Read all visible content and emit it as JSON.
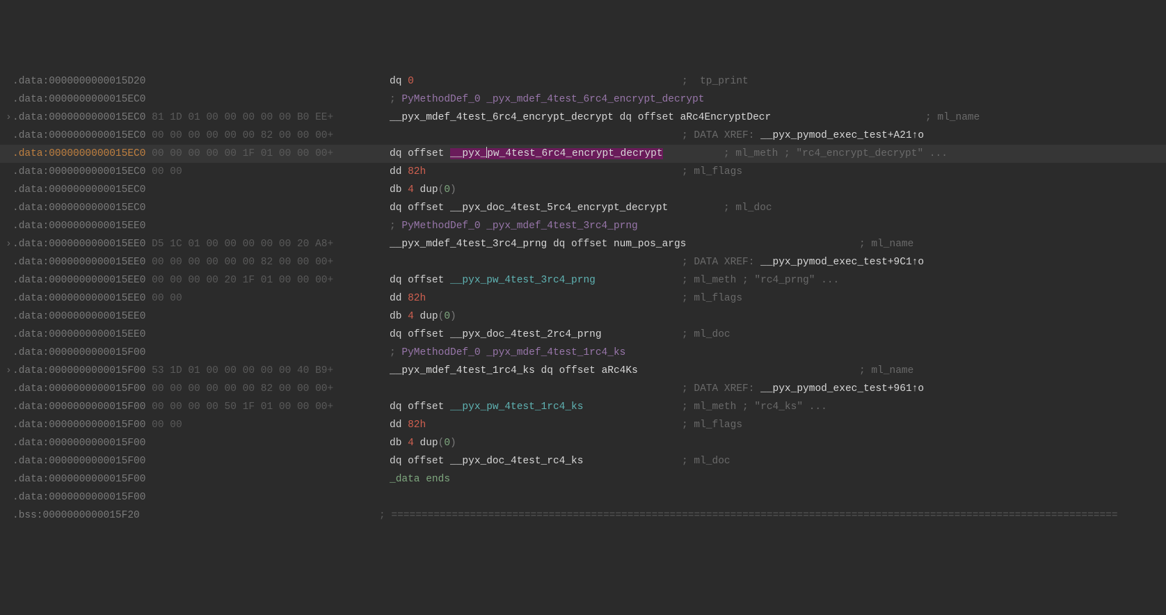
{
  "colors": {
    "bg": "#2b2b2b",
    "highlightBg": "#363636",
    "selBg": "#6a1b5a"
  },
  "lines": [
    {
      "addr": ".data:0000000000015D20",
      "hex": "",
      "parts": [
        {
          "t": "dq ",
          "c": "instr-white"
        },
        {
          "t": "0",
          "c": "num-red"
        }
      ],
      "tail": ";  tp_print",
      "tailCol": 980
    },
    {
      "addr": ".data:0000000000015EC0",
      "hex": "",
      "parts": [
        {
          "t": "; ",
          "c": "comment-gray"
        },
        {
          "t": "PyMethodDef_0 _pyx_mdef_4test_6rc4_encrypt_decrypt",
          "c": "comment-purple"
        }
      ]
    },
    {
      "arrow": "›",
      "addr": ".data:0000000000015EC0",
      "hex": " 81 1D 01 00 00 00 00 00 B0 EE+",
      "parts": [
        {
          "t": "__pyx_mdef_4test_6rc4_encrypt_decrypt",
          "c": "symbol-white"
        },
        {
          "t": " dq offset ",
          "c": "instr-white"
        },
        {
          "t": "aRc4EncryptDecr",
          "c": "symbol-white"
        }
      ],
      "tail": "; ml_name",
      "tailCol": 1330
    },
    {
      "addr": ".data:0000000000015EC0",
      "hex": " 00 00 00 00 00 00 82 00 00 00+",
      "parts": [],
      "tail": "; DATA XREF: __pyx_pymod_exec_test+A21↑o",
      "tailCol": 980,
      "tailWhite": true
    },
    {
      "hl": true,
      "addr": ".data:0000000000015EC0",
      "addrClass": "seg-orange",
      "hex": " 00 00 00 00 00 1F 01 00 00 00+",
      "parts": [
        {
          "t": "dq offset ",
          "c": "instr-white"
        },
        {
          "t": "__pyx_",
          "c": "highlight-sym"
        },
        {
          "cursor": true
        },
        {
          "t": "pw_4test_6rc4_encrypt_decrypt",
          "c": "highlight-sym"
        }
      ],
      "tail": "; ml_meth ; \"rc4_encrypt_decrypt\" ...",
      "tailCol": 1040
    },
    {
      "addr": ".data:0000000000015EC0",
      "hex": " 00 00",
      "parts": [
        {
          "t": "dd ",
          "c": "instr-white"
        },
        {
          "t": "82h",
          "c": "num-red"
        }
      ],
      "tail": "; ml_flags",
      "tailCol": 980
    },
    {
      "addr": ".data:0000000000015EC0",
      "hex": "",
      "parts": [
        {
          "t": "db ",
          "c": "instr-white"
        },
        {
          "t": "4",
          "c": "num-red"
        },
        {
          "t": " dup",
          "c": "instr-white"
        },
        {
          "t": "(",
          "c": "paren-gray"
        },
        {
          "t": "0",
          "c": "num-green"
        },
        {
          "t": ")",
          "c": "paren-gray"
        }
      ]
    },
    {
      "addr": ".data:0000000000015EC0",
      "hex": "",
      "parts": [
        {
          "t": "dq offset ",
          "c": "instr-white"
        },
        {
          "t": "__pyx_doc_4test_5rc4_encrypt_decrypt",
          "c": "symbol-white"
        }
      ],
      "tail": "; ml_doc",
      "tailCol": 1040
    },
    {
      "addr": ".data:0000000000015EE0",
      "hex": "",
      "parts": [
        {
          "t": "; ",
          "c": "comment-gray"
        },
        {
          "t": "PyMethodDef_0 _pyx_mdef_4test_3rc4_prng",
          "c": "comment-purple"
        }
      ]
    },
    {
      "arrow": "›",
      "addr": ".data:0000000000015EE0",
      "hex": " D5 1C 01 00 00 00 00 00 20 A8+",
      "parts": [
        {
          "t": "__pyx_mdef_4test_3rc4_prng",
          "c": "symbol-white"
        },
        {
          "t": " dq offset ",
          "c": "instr-white"
        },
        {
          "t": "num_pos_args",
          "c": "symbol-white"
        }
      ],
      "tail": "; ml_name",
      "tailCol": 1235
    },
    {
      "addr": ".data:0000000000015EE0",
      "hex": " 00 00 00 00 00 00 82 00 00 00+",
      "parts": [],
      "tail": "; DATA XREF: __pyx_pymod_exec_test+9C1↑o",
      "tailCol": 980,
      "tailWhite": true
    },
    {
      "addr": ".data:0000000000015EE0",
      "hex": " 00 00 00 00 20 1F 01 00 00 00+",
      "parts": [
        {
          "t": "dq offset ",
          "c": "instr-white"
        },
        {
          "t": "__pyx_pw_4test_3rc4_prng",
          "c": "symbol-teal"
        }
      ],
      "tail": "; ml_meth ; \"rc4_prng\" ...",
      "tailCol": 980
    },
    {
      "addr": ".data:0000000000015EE0",
      "hex": " 00 00",
      "parts": [
        {
          "t": "dd ",
          "c": "instr-white"
        },
        {
          "t": "82h",
          "c": "num-red"
        }
      ],
      "tail": "; ml_flags",
      "tailCol": 980
    },
    {
      "addr": ".data:0000000000015EE0",
      "hex": "",
      "parts": [
        {
          "t": "db ",
          "c": "instr-white"
        },
        {
          "t": "4",
          "c": "num-red"
        },
        {
          "t": " dup",
          "c": "instr-white"
        },
        {
          "t": "(",
          "c": "paren-gray"
        },
        {
          "t": "0",
          "c": "num-green"
        },
        {
          "t": ")",
          "c": "paren-gray"
        }
      ]
    },
    {
      "addr": ".data:0000000000015EE0",
      "hex": "",
      "parts": [
        {
          "t": "dq offset ",
          "c": "instr-white"
        },
        {
          "t": "__pyx_doc_4test_2rc4_prng",
          "c": "symbol-white"
        }
      ],
      "tail": "; ml_doc",
      "tailCol": 980
    },
    {
      "addr": ".data:0000000000015F00",
      "hex": "",
      "parts": [
        {
          "t": "; ",
          "c": "comment-gray"
        },
        {
          "t": "PyMethodDef_0 _pyx_mdef_4test_1rc4_ks",
          "c": "comment-purple"
        }
      ]
    },
    {
      "arrow": "›",
      "addr": ".data:0000000000015F00",
      "hex": " 53 1D 01 00 00 00 00 00 40 B9+",
      "parts": [
        {
          "t": "__pyx_mdef_4test_1rc4_ks",
          "c": "symbol-white"
        },
        {
          "t": " dq offset ",
          "c": "instr-white"
        },
        {
          "t": "aRc4Ks",
          "c": "symbol-white"
        }
      ],
      "tail": "; ml_name",
      "tailCol": 1235
    },
    {
      "addr": ".data:0000000000015F00",
      "hex": " 00 00 00 00 00 00 82 00 00 00+",
      "parts": [],
      "tail": "; DATA XREF: __pyx_pymod_exec_test+961↑o",
      "tailCol": 980,
      "tailWhite": true
    },
    {
      "addr": ".data:0000000000015F00",
      "hex": " 00 00 00 00 50 1F 01 00 00 00+",
      "parts": [
        {
          "t": "dq offset ",
          "c": "instr-white"
        },
        {
          "t": "__pyx_pw_4test_1rc4_ks",
          "c": "symbol-teal"
        }
      ],
      "tail": "; ml_meth ; \"rc4_ks\" ...",
      "tailCol": 980
    },
    {
      "addr": ".data:0000000000015F00",
      "hex": " 00 00",
      "parts": [
        {
          "t": "dd ",
          "c": "instr-white"
        },
        {
          "t": "82h",
          "c": "num-red"
        }
      ],
      "tail": "; ml_flags",
      "tailCol": 980
    },
    {
      "addr": ".data:0000000000015F00",
      "hex": "",
      "parts": [
        {
          "t": "db ",
          "c": "instr-white"
        },
        {
          "t": "4",
          "c": "num-red"
        },
        {
          "t": " dup",
          "c": "instr-white"
        },
        {
          "t": "(",
          "c": "paren-gray"
        },
        {
          "t": "0",
          "c": "num-green"
        },
        {
          "t": ")",
          "c": "paren-gray"
        }
      ]
    },
    {
      "addr": ".data:0000000000015F00",
      "hex": "",
      "parts": [
        {
          "t": "dq offset ",
          "c": "instr-white"
        },
        {
          "t": "__pyx_doc_4test_rc4_ks",
          "c": "symbol-white"
        }
      ],
      "tail": "; ml_doc",
      "tailCol": 980
    },
    {
      "addr": ".data:0000000000015F00",
      "hex": "",
      "parts": [
        {
          "t": "_data ",
          "c": "dataends"
        },
        {
          "t": "ends",
          "c": "dataends"
        }
      ]
    },
    {
      "addr": ".data:0000000000015F00",
      "hex": "",
      "parts": []
    },
    {
      "addr": ".bss:0000000000015F20",
      "hex": "",
      "sep": true
    }
  ]
}
